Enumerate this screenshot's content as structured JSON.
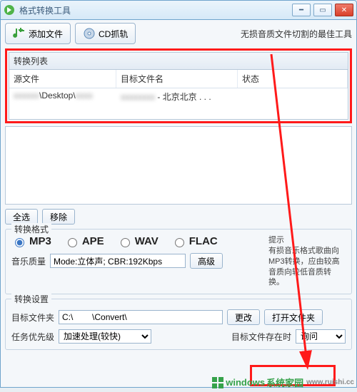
{
  "window": {
    "title": "格式转换工具"
  },
  "toolbar": {
    "add_file": "添加文件",
    "cd_rip": "CD抓轨",
    "tagline": "无损音质文件切割的最佳工具"
  },
  "list": {
    "header": "转换列表",
    "columns": {
      "c1": "源文件",
      "c2": "目标文件名",
      "c3": "状态"
    },
    "row1": {
      "src_blur": "\\Desktop\\",
      "tgt_blur": "- 北京北京 . . ."
    }
  },
  "actions": {
    "select_all": "全选",
    "remove": "移除"
  },
  "format": {
    "legend": "转换格式",
    "mp3": "MP3",
    "ape": "APE",
    "wav": "WAV",
    "flac": "FLAC",
    "hint_title": "提示",
    "hint_body": "有损音乐格式歌曲向MP3转换，应由较高音质向较低音质转换。",
    "quality_label": "音乐质量",
    "quality_value": "Mode:立体声; CBR:192Kbps",
    "advanced": "高级"
  },
  "settings": {
    "legend": "转换设置",
    "target_label": "目标文件夹",
    "target_value": "C:\\        \\Convert\\",
    "change": "更改",
    "open_folder": "打开文件夹",
    "priority_label": "任务优先级",
    "priority_value": "加速处理(较快)",
    "exists_label": "目标文件存在时",
    "exists_value": "询问"
  },
  "watermark": {
    "brand": "windows",
    "suffix": "系统家园",
    "url": "www.ruishi.cc"
  }
}
